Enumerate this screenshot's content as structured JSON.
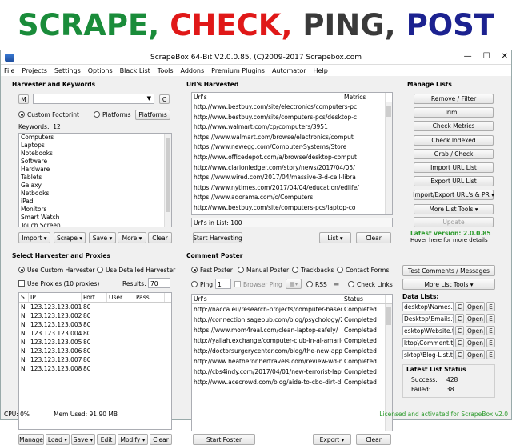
{
  "banner": {
    "w1": "SCRAPE,",
    "w2": "CHECK,",
    "w3": "PING,",
    "w4": "POST",
    "c1": "#1a8c3a",
    "c2": "#e01818",
    "c3": "#3a3a3a",
    "c4": "#1c2290"
  },
  "window": {
    "title": "ScrapeBox 64-Bit V2.0.0.85, (C)2009-2017 Scrapebox.com"
  },
  "menu": [
    "File",
    "Projects",
    "Settings",
    "Options",
    "Black List",
    "Tools",
    "Addons",
    "Premium Plugins",
    "Automator",
    "Help"
  ],
  "harvester": {
    "title": "Harvester and Keywords",
    "m_label": "M",
    "c_label": "C",
    "custom_footprint": "Custom Footprint",
    "platforms_radio": "Platforms",
    "platforms_btn": "Platforms",
    "keywords_label": "Keywords:",
    "keywords_count": "12",
    "keywords": [
      "Computers",
      "Laptops",
      "Notebooks",
      "Software",
      "Hardware",
      "Tablets",
      "Galaxy",
      "Netbooks",
      "iPad",
      "Monitors",
      "Smart Watch",
      "Touch Screen"
    ],
    "buttons": [
      "Import",
      "Scrape",
      "Save",
      "More",
      "Clear"
    ]
  },
  "urls": {
    "title": "Url's Harvested",
    "col1": "Url's",
    "col2": "Metrics",
    "items": [
      "http://www.bestbuy.com/site/electronics/computers-pc",
      "http://www.bestbuy.com/site/computers-pcs/desktop-c",
      "http://www.walmart.com/cp/computers/3951",
      "https://www.walmart.com/browse/electronics/comput",
      "https://www.newegg.com/Computer-Systems/Store",
      "http://www.officedepot.com/a/browse/desktop-comput",
      "http://www.clarionledger.com/story/news/2017/04/05/",
      "https://www.wired.com/2017/04/massive-3-d-cell-libra",
      "https://www.nytimes.com/2017/04/04/education/edlife/",
      "https://www.adorama.com/c/Computers",
      "http://www.bestbuy.com/site/computers-pcs/laptop-co"
    ],
    "count_label": "Url's in List: 100",
    "start_btn": "Start Harvesting",
    "list_btn": "List",
    "clear_btn": "Clear"
  },
  "manage": {
    "title": "Manage Lists",
    "buttons": [
      "Remove / Filter",
      "Trim...",
      "Check Metrics",
      "Check Indexed",
      "Grab / Check",
      "Import URL List",
      "Export URL List",
      "Import/Export URL's & PR",
      "More List Tools"
    ],
    "update_btn": "Update",
    "latest_version": "Latest version: 2.0.0.85",
    "hover_note": "Hover here for more details"
  },
  "proxies": {
    "title": "Select Harvester and Proxies",
    "use_custom": "Use Custom Harvester",
    "use_detailed": "Use Detailed Harvester",
    "use_proxies": "Use Proxies  (10 proxies)",
    "results_label": "Results:",
    "results_value": "70",
    "cols": [
      "S",
      "IP",
      "Port",
      "User",
      "Pass"
    ],
    "rows": [
      {
        "s": "N",
        "ip": "123.123.123.001",
        "port": "80"
      },
      {
        "s": "N",
        "ip": "123.123.123.002",
        "port": "80"
      },
      {
        "s": "N",
        "ip": "123.123.123.003",
        "port": "80"
      },
      {
        "s": "N",
        "ip": "123.123.123.004",
        "port": "80"
      },
      {
        "s": "N",
        "ip": "123.123.123.005",
        "port": "80"
      },
      {
        "s": "N",
        "ip": "123.123.123.006",
        "port": "80"
      },
      {
        "s": "N",
        "ip": "123.123.123.007",
        "port": "80"
      },
      {
        "s": "N",
        "ip": "123.123.123.008",
        "port": "80"
      }
    ],
    "buttons": [
      "Manage",
      "Load",
      "Save",
      "Edit",
      "Modify",
      "Clear"
    ]
  },
  "poster": {
    "title": "Comment Poster",
    "fast": "Fast Poster",
    "manual": "Manual Poster",
    "trackbacks": "Trackbacks",
    "contact": "Contact Forms",
    "ping": "Ping",
    "ping_value": "1",
    "browser_ping": "Browser Ping",
    "rss": "RSS",
    "check_links": "Check Links",
    "col1": "Url's",
    "col2": "Status",
    "items": [
      {
        "url": "http://nacca.eu/research-projects/computer-based-art",
        "status": "Completed"
      },
      {
        "url": "http://connection.sagepub.com/blog/psychology/2017/",
        "status": "Completed"
      },
      {
        "url": "https://www.mom4real.com/clean-laptop-safely/",
        "status": "Completed"
      },
      {
        "url": "http://yallah.exchange/computer-club-in-al-amari-refu",
        "status": "Completed"
      },
      {
        "url": "http://doctorsurgerycenter.com/blog/the-new-apple-m",
        "status": "Completed"
      },
      {
        "url": "http://www.heatheronhertravels.com/review-wd-my-pa",
        "status": "Completed"
      },
      {
        "url": "http://cbs4indy.com/2017/04/01/new-terrorist-laptop-b",
        "status": "Completed"
      },
      {
        "url": "http://www.acecrowd.com/blog/aide-to-cbd-dirt-dau",
        "status": "Completed"
      }
    ],
    "start_btn": "Start Poster",
    "export_btn": "Export",
    "clear_btn": "Clear"
  },
  "right_tools": {
    "test_btn": "Test Comments / Messages",
    "more_btn": "More List Tools",
    "data_lists_title": "Data Lists:",
    "data_lists": [
      "desktop\\Names.txt",
      "Desktop\\Emails.txt",
      "esktop\\Website.txt",
      "ktop\\Comment.txt",
      "sktop\\Blog-List.txt"
    ],
    "c_btn": "C",
    "open_btn": "Open",
    "e_btn": "E",
    "latest_status_title": "Latest List Status",
    "success_label": "Success:",
    "success_value": "428",
    "failed_label": "Failed:",
    "failed_value": "38"
  },
  "statusbar": {
    "cpu": "CPU:  0%",
    "mem": "Mem Used: 91.90 MB",
    "license": "Licensed and activated for ScrapeBox v2.0"
  }
}
